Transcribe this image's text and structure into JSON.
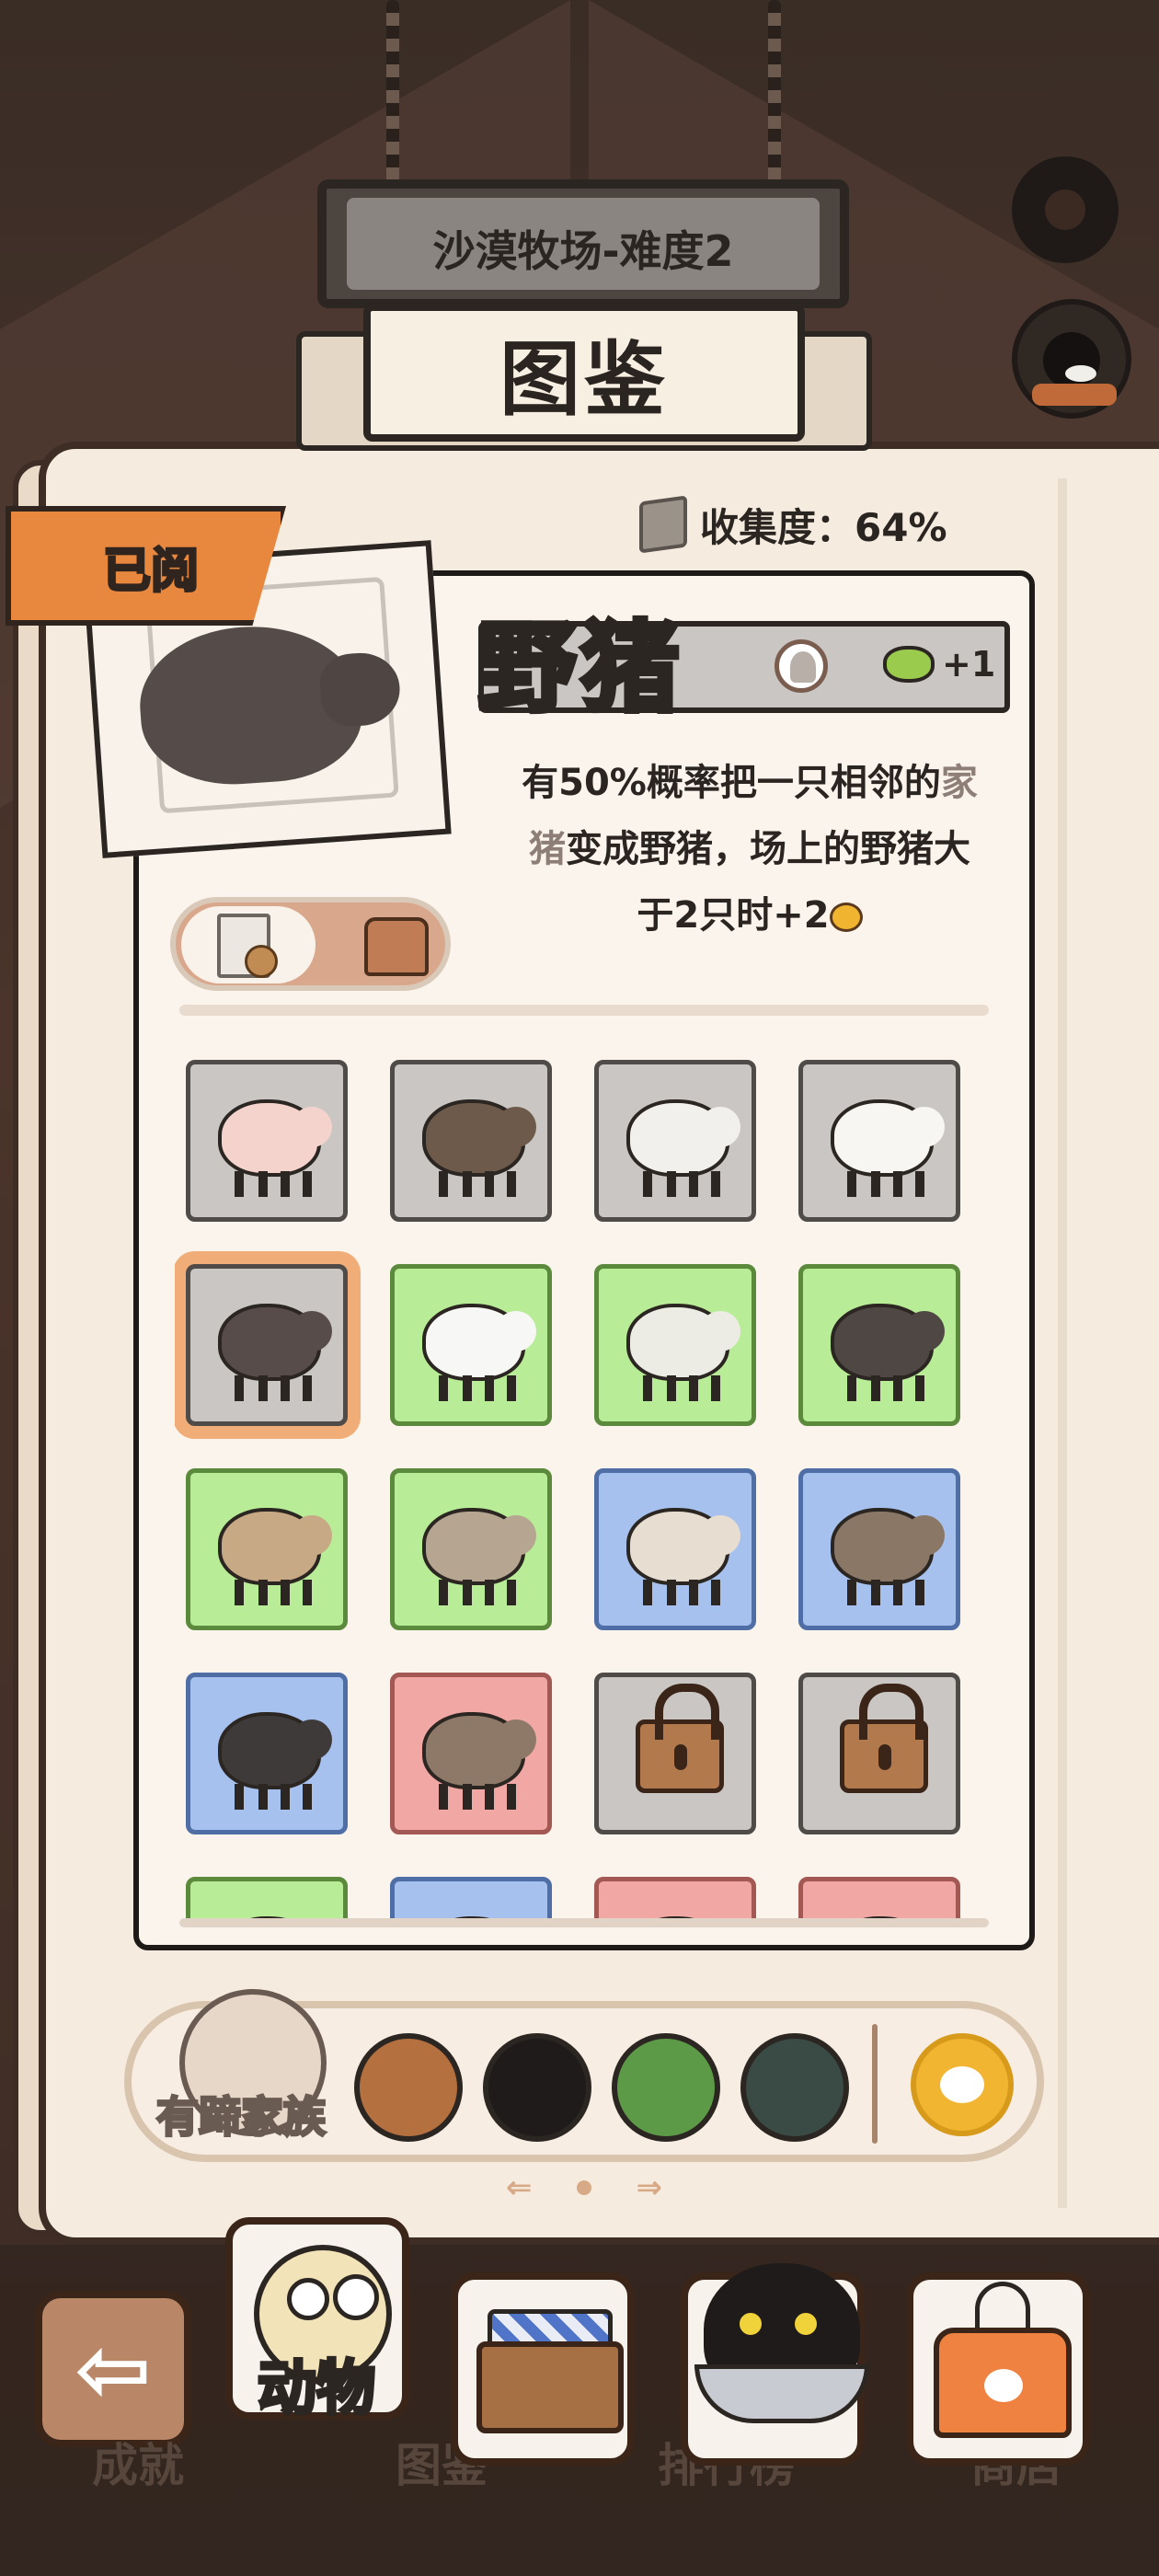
{
  "header": {
    "farm_title": "沙漠牧场-难度2",
    "page_title": "图鉴"
  },
  "status": {
    "read_badge": "已阅",
    "collection_label": "收集度：64%"
  },
  "detail": {
    "name": "野猪",
    "bonus": "+1",
    "description_parts": {
      "p1": "有50%概率把一只相邻的",
      "hl1": "家",
      "hl2": "猪",
      "p2": "变成野猪，场上的野猪大",
      "p3": "于2只时+2"
    }
  },
  "grid": {
    "tiles": [
      {
        "animal": "pig",
        "bg": "gray"
      },
      {
        "animal": "cow-brown",
        "bg": "gray"
      },
      {
        "animal": "sheep",
        "bg": "gray"
      },
      {
        "animal": "goat-white",
        "bg": "gray"
      },
      {
        "animal": "wild-boar",
        "bg": "gray",
        "selected": true
      },
      {
        "animal": "dairy-cow",
        "bg": "green"
      },
      {
        "animal": "mountain-goat",
        "bg": "green"
      },
      {
        "animal": "bison",
        "bg": "green"
      },
      {
        "animal": "gazelle",
        "bg": "green"
      },
      {
        "animal": "camel",
        "bg": "green"
      },
      {
        "animal": "alpaca",
        "bg": "blue"
      },
      {
        "animal": "deer",
        "bg": "blue"
      },
      {
        "animal": "muskox",
        "bg": "blue"
      },
      {
        "animal": "doe",
        "bg": "red"
      },
      {
        "animal": "locked",
        "bg": "gray"
      },
      {
        "animal": "locked",
        "bg": "gray"
      },
      {
        "animal": "partial",
        "bg": "green"
      },
      {
        "animal": "partial",
        "bg": "blue"
      },
      {
        "animal": "partial",
        "bg": "red"
      },
      {
        "animal": "partial",
        "bg": "red"
      }
    ]
  },
  "family_bar": {
    "current_family": "有蹄家族",
    "families": [
      "hoof-family-icon",
      "poultry-family-icon",
      "predator-family-icon",
      "bird-family-icon",
      "rodent-family-icon"
    ],
    "paw_icon": "paw-icon"
  },
  "bottom_nav": {
    "back_icon": "back-arrow-icon",
    "achievements": "成就",
    "animals": "动物",
    "gallery": "图鉴",
    "ranking": "排行榜",
    "shop": "商店"
  },
  "colors": {
    "accent_orange": "#e8873e",
    "selected_outline": "#f0ad78",
    "tile_gray": "#c9c6c3",
    "tile_green": "#b8ec96",
    "tile_blue": "#a7c1ee",
    "tile_red": "#f1a7a3"
  }
}
